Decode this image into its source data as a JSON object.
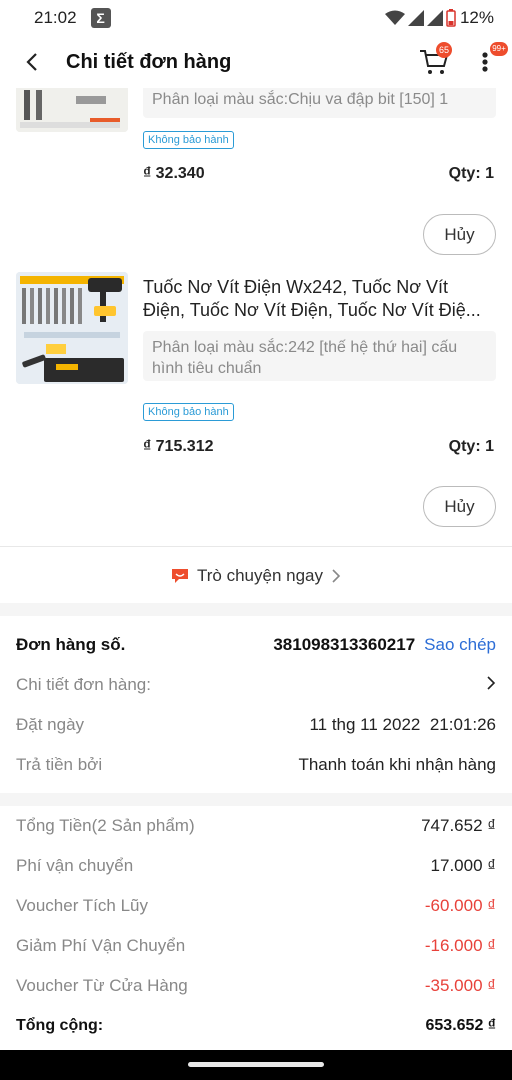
{
  "status_bar": {
    "time": "21:02",
    "battery": "12%"
  },
  "header": {
    "title": "Chi tiết đơn hàng",
    "cart_badge": "65",
    "more_badge": "99+"
  },
  "products": [
    {
      "variant": "Phân loại màu sắc:Chịu va đập bit [150] 1",
      "warranty": "Không bảo hành",
      "price": "₫ 32.340",
      "qty": "Qty: 1",
      "cancel_label": "Hủy"
    },
    {
      "name": "Tuốc Nơ Vít Điện Wx242, Tuốc Nơ Vít Điện, Tuốc Nơ Vít Điện, Tuốc Nơ Vít Điệ...",
      "variant": "Phân loại màu sắc:242 [thế hệ thứ hai] cấu hình tiêu chuẩn",
      "warranty": "Không bảo hành",
      "price": "₫ 715.312",
      "qty": "Qty: 1",
      "cancel_label": "Hủy"
    }
  ],
  "chat": {
    "label": "Trò chuyện ngay"
  },
  "order_info": {
    "order_label": "Đơn hàng số.",
    "order_number": "381098313360217",
    "copy_label": "Sao chép",
    "detail_label": "Chi tiết đơn hàng:",
    "date_label": "Đặt ngày",
    "date_value": "11 thg 11 2022  21:01:26",
    "payment_label": "Trả tiền bởi",
    "payment_value": "Thanh toán khi nhận hàng"
  },
  "summary": [
    {
      "label": "Tổng Tiền(2 Sản phẩm)",
      "value": "747.652 ₫",
      "negative": false
    },
    {
      "label": "Phí vận chuyển",
      "value": "17.000 ₫",
      "negative": false
    },
    {
      "label": "Voucher Tích Lũy",
      "value": "-60.000 ₫",
      "negative": true
    },
    {
      "label": "Giảm Phí Vận Chuyển",
      "value": "-16.000 ₫",
      "negative": true
    },
    {
      "label": "Voucher Từ Cửa Hàng",
      "value": "-35.000 ₫",
      "negative": true
    }
  ],
  "total": {
    "label": "Tổng cộng:",
    "value": "653.652 ₫"
  },
  "colors": {
    "accent": "#ee4d2d",
    "link": "#2c6dd6",
    "negative": "#e8413a",
    "warranty": "#2b9bd6"
  },
  "icons": [
    "sigma-icon",
    "wifi-icon",
    "signal-icon",
    "battery-icon",
    "back-arrow-icon",
    "cart-icon",
    "more-vert-icon",
    "chat-bubble-icon",
    "chevron-right-icon"
  ]
}
